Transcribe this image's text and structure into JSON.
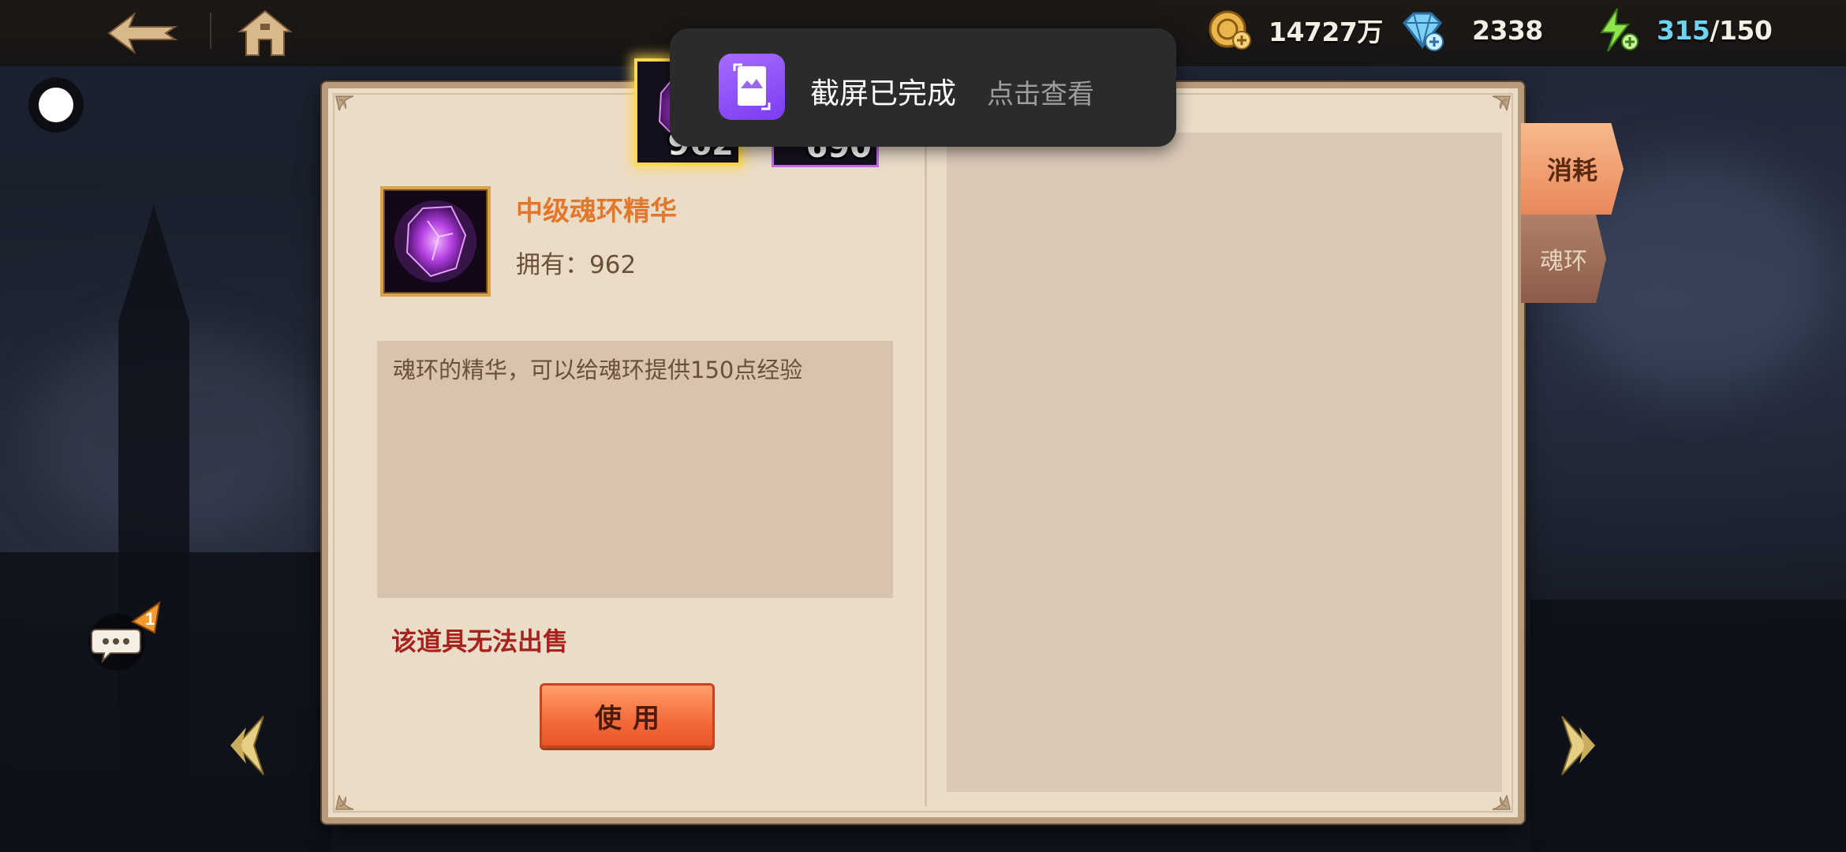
{
  "topbar": {
    "gold": {
      "icon": "gold-coin-plus-icon",
      "value": "14727万"
    },
    "diamond": {
      "icon": "diamond-plus-icon",
      "value": "2338"
    },
    "energy": {
      "icon": "lightning-plus-icon",
      "current": "315",
      "max": "/150"
    }
  },
  "toast": {
    "title": "截屏已完成",
    "action": "点击查看",
    "icon": "screenshot-icon"
  },
  "item_detail": {
    "name": "中级魂环精华",
    "owned_label": "拥有：",
    "owned_value": "962",
    "description": "魂环的精华，可以给魂环提供150点经验",
    "unsellable_note": "该道具无法出售",
    "use_label": "使用"
  },
  "inventory": {
    "slots": [
      {
        "name": "purple-soul-crystal",
        "count": "962",
        "selected": true
      },
      {
        "name": "blue-soul-crystal",
        "count": "690",
        "selected": false
      }
    ]
  },
  "tabs": [
    {
      "label": "消耗",
      "active": true
    },
    {
      "label": "魂环",
      "active": false
    }
  ],
  "chat": {
    "badge": "1"
  },
  "colors": {
    "panel_bg": "#ebdcc8",
    "item_name": "#e2782c",
    "unsellable": "#a6231e",
    "use_button": "#f46a3a",
    "energy_current": "#6fd3f2"
  }
}
